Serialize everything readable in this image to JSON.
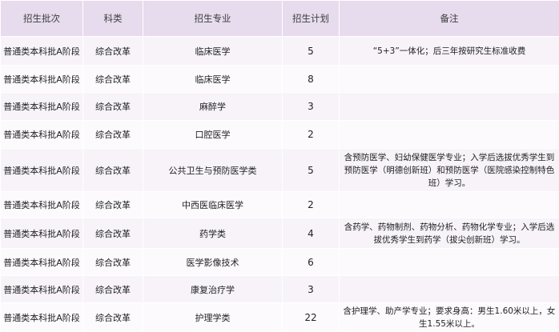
{
  "headers": [
    "招生批次",
    "科类",
    "招生专业",
    "招生计划",
    "备注"
  ],
  "rows": [
    {
      "batch": "普通类本科批A阶段",
      "category": "综合改革",
      "major": "临床医学",
      "plan": "5",
      "note": "“5+3”一体化；后三年按研究生标准收费"
    },
    {
      "batch": "普通类本科批A阶段",
      "category": "综合改革",
      "major": "临床医学",
      "plan": "8",
      "note": ""
    },
    {
      "batch": "普通类本科批A阶段",
      "category": "综合改革",
      "major": "麻醉学",
      "plan": "3",
      "note": ""
    },
    {
      "batch": "普通类本科批A阶段",
      "category": "综合改革",
      "major": "口腔医学",
      "plan": "2",
      "note": ""
    },
    {
      "batch": "普通类本科批A阶段",
      "category": "综合改革",
      "major": "公共卫生与预防医学类",
      "plan": "5",
      "note": "含预防医学、妇幼保健医学专业；入学后选拔优秀学生到预防医学（明德创新班）和预防医学（医院感染控制特色班）学习。"
    },
    {
      "batch": "普通类本科批A阶段",
      "category": "综合改革",
      "major": "中西医临床医学",
      "plan": "2",
      "note": ""
    },
    {
      "batch": "普通类本科批A阶段",
      "category": "综合改革",
      "major": "药学类",
      "plan": "4",
      "note": "含药学、药物制剂、药物分析、药物化学专业；入学后选拔优秀学生到药学（拔尖创新班）学习。"
    },
    {
      "batch": "普通类本科批A阶段",
      "category": "综合改革",
      "major": "医学影像技术",
      "plan": "6",
      "note": ""
    },
    {
      "batch": "普通类本科批A阶段",
      "category": "综合改革",
      "major": "康复治疗学",
      "plan": "3",
      "note": ""
    },
    {
      "batch": "普通类本科批A阶段",
      "category": "综合改革",
      "major": "护理学类",
      "plan": "22",
      "note": "含护理学、助产学专业；要求身高：男生1.60米以上，女生1.55米以上。"
    }
  ]
}
